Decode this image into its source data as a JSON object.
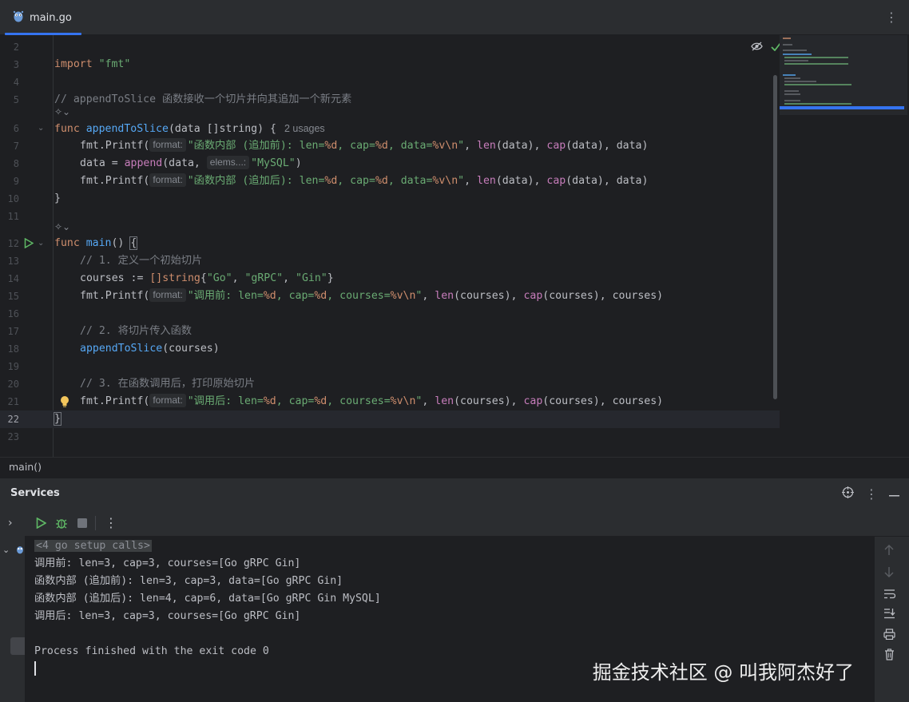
{
  "tab": {
    "filename": "main.go"
  },
  "editor": {
    "lines": [
      {
        "num": "2"
      },
      {
        "num": "3"
      },
      {
        "num": "4"
      },
      {
        "num": "5"
      },
      {
        "num": "6"
      },
      {
        "num": "7"
      },
      {
        "num": "8"
      },
      {
        "num": "9"
      },
      {
        "num": "10"
      },
      {
        "num": "11"
      },
      {
        "num": "12"
      },
      {
        "num": "13"
      },
      {
        "num": "14"
      },
      {
        "num": "15"
      },
      {
        "num": "16"
      },
      {
        "num": "17"
      },
      {
        "num": "18"
      },
      {
        "num": "19"
      },
      {
        "num": "20"
      },
      {
        "num": "21"
      },
      {
        "num": "22"
      },
      {
        "num": "23"
      }
    ],
    "code": {
      "l3_kw": "import",
      "l3_str": "\"fmt\"",
      "l5_comment": "// appendToSlice 函数接收一个切片并向其追加一个新元素",
      "l6_kw": "func",
      "l6_fn": "appendToSlice",
      "l6_rest": "(data []string) ",
      "l6_brace": "{",
      "l6_usages": "2 usages",
      "l7_call": "fmt.Printf(",
      "l7_hint": "format:",
      "l7_str": "\"函数内部 (追加前): len=",
      "l7_pc1": "%d",
      "l7_str2": ", cap=",
      "l7_pc2": "%d",
      "l7_str3": ", data=",
      "l7_pc3": "%v\\n",
      "l7_str4": "\"",
      "l7_tail_a": ", ",
      "l7_len": "len",
      "l7_tail_b": "(data), ",
      "l7_cap": "cap",
      "l7_tail_c": "(data), data)",
      "l8_head": "data = ",
      "l8_append": "append",
      "l8_mid": "(data, ",
      "l8_hint": "elems...:",
      "l8_str": "\"MySQL\"",
      "l8_tail": ")",
      "l9_call": "fmt.Printf(",
      "l9_hint": "format:",
      "l9_str": "\"函数内部 (追加后): len=",
      "l9_pc1": "%d",
      "l9_str2": ", cap=",
      "l9_pc2": "%d",
      "l9_str3": ", data=",
      "l9_pc3": "%v\\n",
      "l9_str4": "\"",
      "l9_tail_a": ", ",
      "l9_len": "len",
      "l9_tail_b": "(data), ",
      "l9_cap": "cap",
      "l9_tail_c": "(data), data)",
      "l10": "}",
      "l12_kw": "func",
      "l12_fn": "main",
      "l12_rest": "() ",
      "l12_brace": "{",
      "l13": "// 1. 定义一个初始切片",
      "l14_head": "courses := ",
      "l14_type": "[]string",
      "l14_b1": "{",
      "l14_s1": "\"Go\"",
      "l14_c1": ", ",
      "l14_s2": "\"gRPC\"",
      "l14_c2": ", ",
      "l14_s3": "\"Gin\"",
      "l14_b2": "}",
      "l15_call": "fmt.Printf(",
      "l15_hint": "format:",
      "l15_str": "\"调用前: len=",
      "l15_pc1": "%d",
      "l15_str2": ", cap=",
      "l15_pc2": "%d",
      "l15_str3": ", courses=",
      "l15_pc3": "%v\\n",
      "l15_str4": "\"",
      "l15_tail_a": ", ",
      "l15_len": "len",
      "l15_tail_b": "(courses), ",
      "l15_cap": "cap",
      "l15_tail_c": "(courses), courses)",
      "l17": "// 2. 将切片传入函数",
      "l18_fn": "appendToSlice",
      "l18_rest": "(courses)",
      "l20": "// 3. 在函数调用后，打印原始切片",
      "l21_call": "fmt.Printf(",
      "l21_hint": "format:",
      "l21_str": "\"调用后: len=",
      "l21_pc1": "%d",
      "l21_str2": ", cap=",
      "l21_pc2": "%d",
      "l21_str3": ", courses=",
      "l21_pc3": "%v\\n",
      "l21_str4": "\"",
      "l21_tail_a": ", ",
      "l21_len": "len",
      "l21_tail_b": "(courses), ",
      "l21_cap": "cap",
      "l21_tail_c": "(courses), courses)",
      "l22": "}"
    }
  },
  "breadcrumb": {
    "label": "main()"
  },
  "services": {
    "title": "Services",
    "console": {
      "setup": "<4 go setup calls>",
      "out1": "调用前: len=3, cap=3, courses=[Go gRPC Gin]",
      "out2": "函数内部 (追加前): len=3, cap=3, data=[Go gRPC Gin]",
      "out3": "函数内部 (追加后): len=4, cap=6, data=[Go gRPC Gin MySQL]",
      "out4": "调用后: len=3, cap=3, courses=[Go gRPC Gin]",
      "exit": "Process finished with the exit code 0"
    },
    "watermark": "掘金技术社区 @ 叫我阿杰好了"
  },
  "colors": {
    "keyword": "#cf8e6d",
    "function": "#56a8f5",
    "string": "#6aab73",
    "comment": "#7a7e85",
    "builtin": "#c77dbb",
    "accent": "#3574f0",
    "run_green": "#5fb865"
  }
}
